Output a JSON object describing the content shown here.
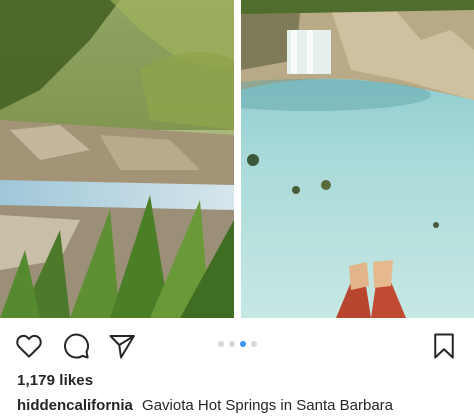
{
  "post": {
    "likes": "1,179 likes",
    "username": "hiddencalifornia",
    "caption": "Gaviota Hot Springs in Santa Barbara"
  },
  "carousel": {
    "dot_count": 4,
    "active_index": 2
  },
  "colors": {
    "accent": "#3897f0",
    "text": "#262626",
    "dot_inactive": "#d8d8d8"
  },
  "icons": {
    "like": "heart-icon",
    "comment": "comment-icon",
    "share": "paper-plane-icon",
    "save": "bookmark-icon"
  }
}
